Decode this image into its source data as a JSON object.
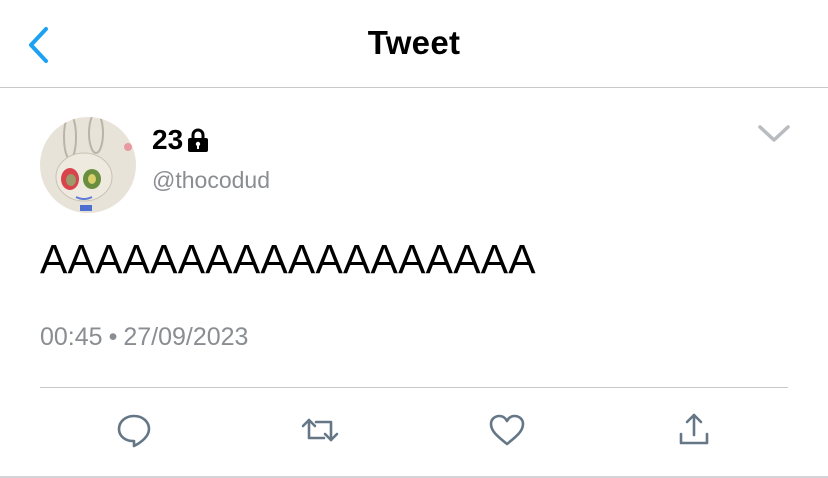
{
  "header": {
    "title": "Tweet",
    "back_icon": "chevron-left-icon",
    "accent": "#1da1f2"
  },
  "tweet": {
    "display_name": "23",
    "protected_icon": "lock-icon",
    "handle": "@thocodud",
    "text": "AAAAAAAAAAAAAAAAAA",
    "time": "00:45",
    "separator": "•",
    "date": "27/09/2023"
  },
  "actions": [
    {
      "name": "reply",
      "icon": "comment-icon"
    },
    {
      "name": "retweet",
      "icon": "retweet-icon"
    },
    {
      "name": "like",
      "icon": "heart-icon"
    },
    {
      "name": "share",
      "icon": "share-icon"
    }
  ],
  "colors": {
    "icon_gray": "#657786",
    "muted_text": "#8a8d91"
  }
}
